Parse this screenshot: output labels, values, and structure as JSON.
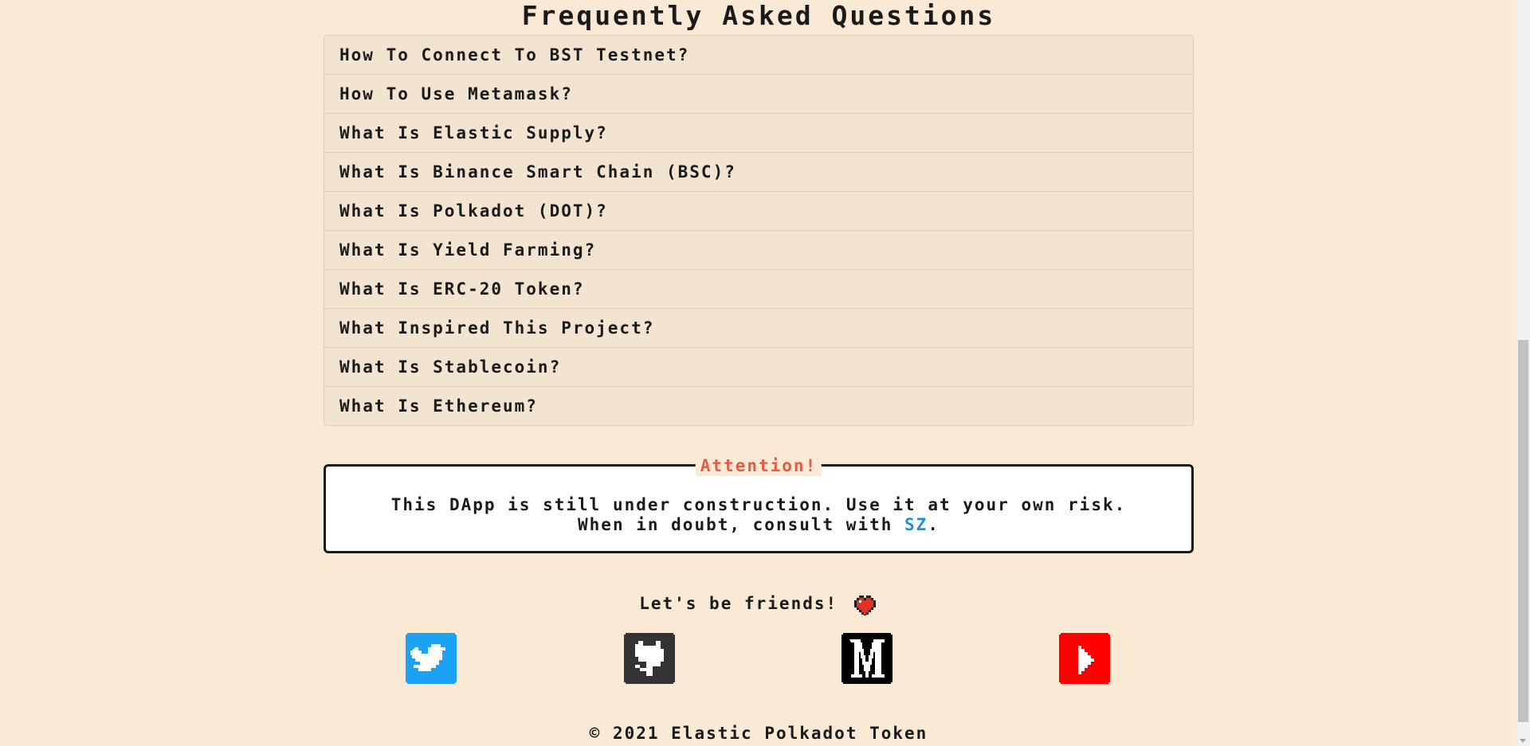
{
  "faq": {
    "title": "Frequently Asked Questions",
    "items": [
      {
        "question": "How To Connect To BST Testnet?"
      },
      {
        "question": "How To Use Metamask?"
      },
      {
        "question": "What Is Elastic Supply?"
      },
      {
        "question": "What Is Binance Smart Chain (BSC)?"
      },
      {
        "question": "What Is Polkadot (DOT)?"
      },
      {
        "question": "What Is Yield Farming?"
      },
      {
        "question": "What Is ERC-20 Token?"
      },
      {
        "question": "What Inspired This Project?"
      },
      {
        "question": "What Is Stablecoin?"
      },
      {
        "question": "What Is Ethereum?"
      }
    ]
  },
  "attention": {
    "title": "Attention!",
    "line1": "This DApp is still under construction. Use it at your own risk.",
    "line2_prefix": "When in doubt, consult with ",
    "link_label": "SZ",
    "line2_suffix": "."
  },
  "footer": {
    "friends_text": "Let's be friends!",
    "copyright": "© 2021 Elastic Polkadot Token"
  },
  "social": [
    {
      "name": "twitter",
      "icon": "twitter-icon",
      "color": "#1da1f2"
    },
    {
      "name": "github",
      "icon": "github-icon",
      "color": "#333333"
    },
    {
      "name": "medium",
      "icon": "medium-icon",
      "color": "#000000"
    },
    {
      "name": "youtube",
      "icon": "youtube-icon",
      "color": "#ff0000"
    }
  ],
  "colors": {
    "background": "#fae9d4",
    "faq_row": "#f3e4d1",
    "attention_title": "#e05c45",
    "link": "#1e8fe0",
    "heart": "#e0312b"
  }
}
